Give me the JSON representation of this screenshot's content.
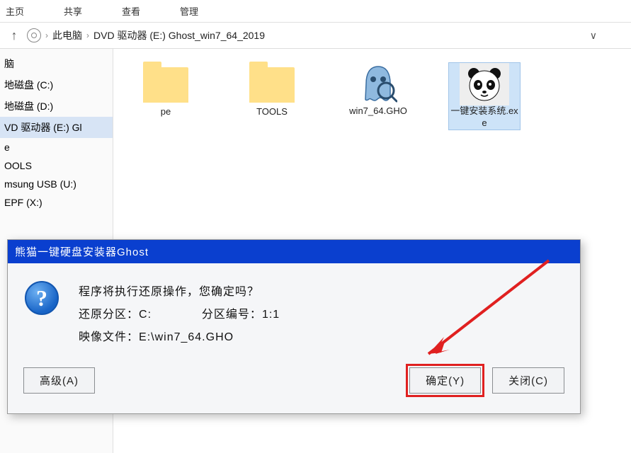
{
  "toolbar": {
    "item1": "主页",
    "item2": "共享",
    "item3": "查看",
    "item4": "管理"
  },
  "breadcrumb": {
    "seg1": "此电脑",
    "seg2": "DVD 驱动器 (E:) Ghost_win7_64_2019"
  },
  "sidebar": {
    "items": [
      "脑",
      "地磁盘 (C:)",
      "地磁盘 (D:)",
      "VD 驱动器 (E:) Gl",
      "e",
      "OOLS",
      "msung USB (U:)",
      "EPF (X:)"
    ]
  },
  "files": {
    "f0": {
      "label": "pe"
    },
    "f1": {
      "label": "TOOLS"
    },
    "f2": {
      "label": "win7_64.GHO"
    },
    "f3": {
      "label": "一键安装系统.exe"
    }
  },
  "dialog": {
    "title": "熊猫一键硬盘安装器Ghost",
    "message": "程序将执行还原操作，您确定吗？",
    "partition_label": "还原分区：",
    "partition_value": "C:",
    "partnum_label": "分区编号：",
    "partnum_value": "1:1",
    "image_label": "映像文件：",
    "image_value": "E:\\win7_64.GHO",
    "btn_advanced": "高级(A)",
    "btn_ok": "确定(Y)",
    "btn_close": "关闭(C)"
  }
}
